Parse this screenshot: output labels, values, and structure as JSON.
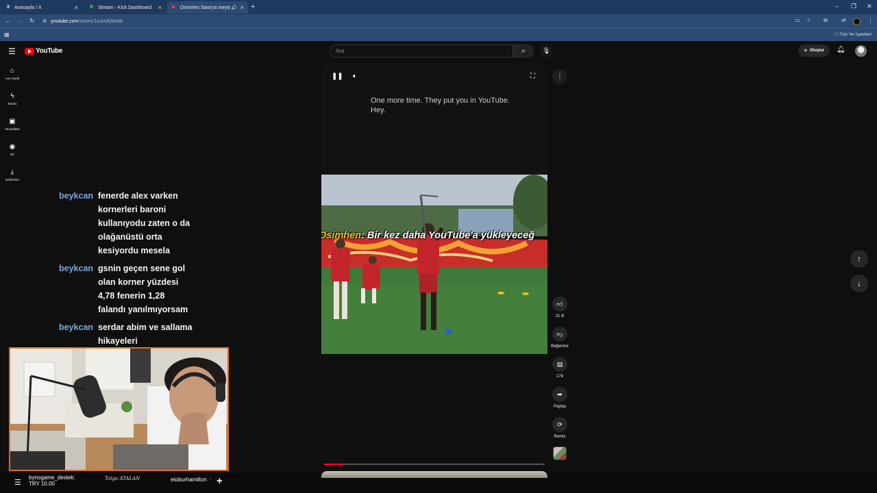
{
  "browser": {
    "tabs": [
      {
        "label": "Anasayfa / X",
        "favicon": "X"
      },
      {
        "label": "Stream - Kick Dashboard",
        "favicon": "K"
      },
      {
        "label": "Osimhen Sara'ya meydan o...",
        "favicon": "▶"
      }
    ],
    "url_host": "youtube.com",
    "url_path": "/shorts/1zcknEjWokk",
    "bookmarks_all": "Tüm Yer İşaretleri",
    "colors": {
      "tabbar": "#203a5f",
      "toolbar": "#2d4a73"
    }
  },
  "youtube": {
    "logo_text": "YouTube",
    "search_placeholder": "Ara",
    "create_label": "Oluştur",
    "nav": [
      {
        "icon": "home-icon",
        "label": "Ana Sayfa"
      },
      {
        "icon": "shorts-icon",
        "label": "Shorts"
      },
      {
        "icon": "subscriptions-icon",
        "label": "Abonelikler"
      },
      {
        "icon": "you-icon",
        "label": "Siz"
      },
      {
        "icon": "downloads-icon",
        "label": "İndirilenler"
      }
    ]
  },
  "short": {
    "caption_lines": [
      "One more time. They put you in YouTube.",
      "Hey."
    ],
    "subtitle_speaker": "Osimhen",
    "subtitle_text": ": Bir kez daha YouTube'a yükleyeceğ",
    "progress": 0.09,
    "like_count": "21 B",
    "dislike_label": "Beğenme",
    "comment_count": "178",
    "share_label": "Paylaş",
    "remix_label": "Remix",
    "accent": "#ff0033"
  },
  "chat": [
    {
      "user": "beykcan",
      "lines": [
        "fenerde alex varken",
        "kornerleri baroni",
        "kullanıyodu zaten o da",
        "olağanüstü orta",
        "kesiyordu mesela"
      ]
    },
    {
      "user": "beykcan",
      "lines": [
        "gsnin geçen sene gol",
        "olan korner yüzdesi",
        "4,78 fenerin 1,28",
        "falandı yanılmıyorsam"
      ]
    },
    {
      "user": "beykcan",
      "lines": [
        "serdar abim ve sallama",
        "hikayeleri"
      ]
    }
  ],
  "bottom_bar": {
    "donor_name": "bynogame_destek:",
    "donor_amount": "TRY 10.00",
    "signature": "Tolga ATALAN",
    "user": "etoburhamilton"
  }
}
